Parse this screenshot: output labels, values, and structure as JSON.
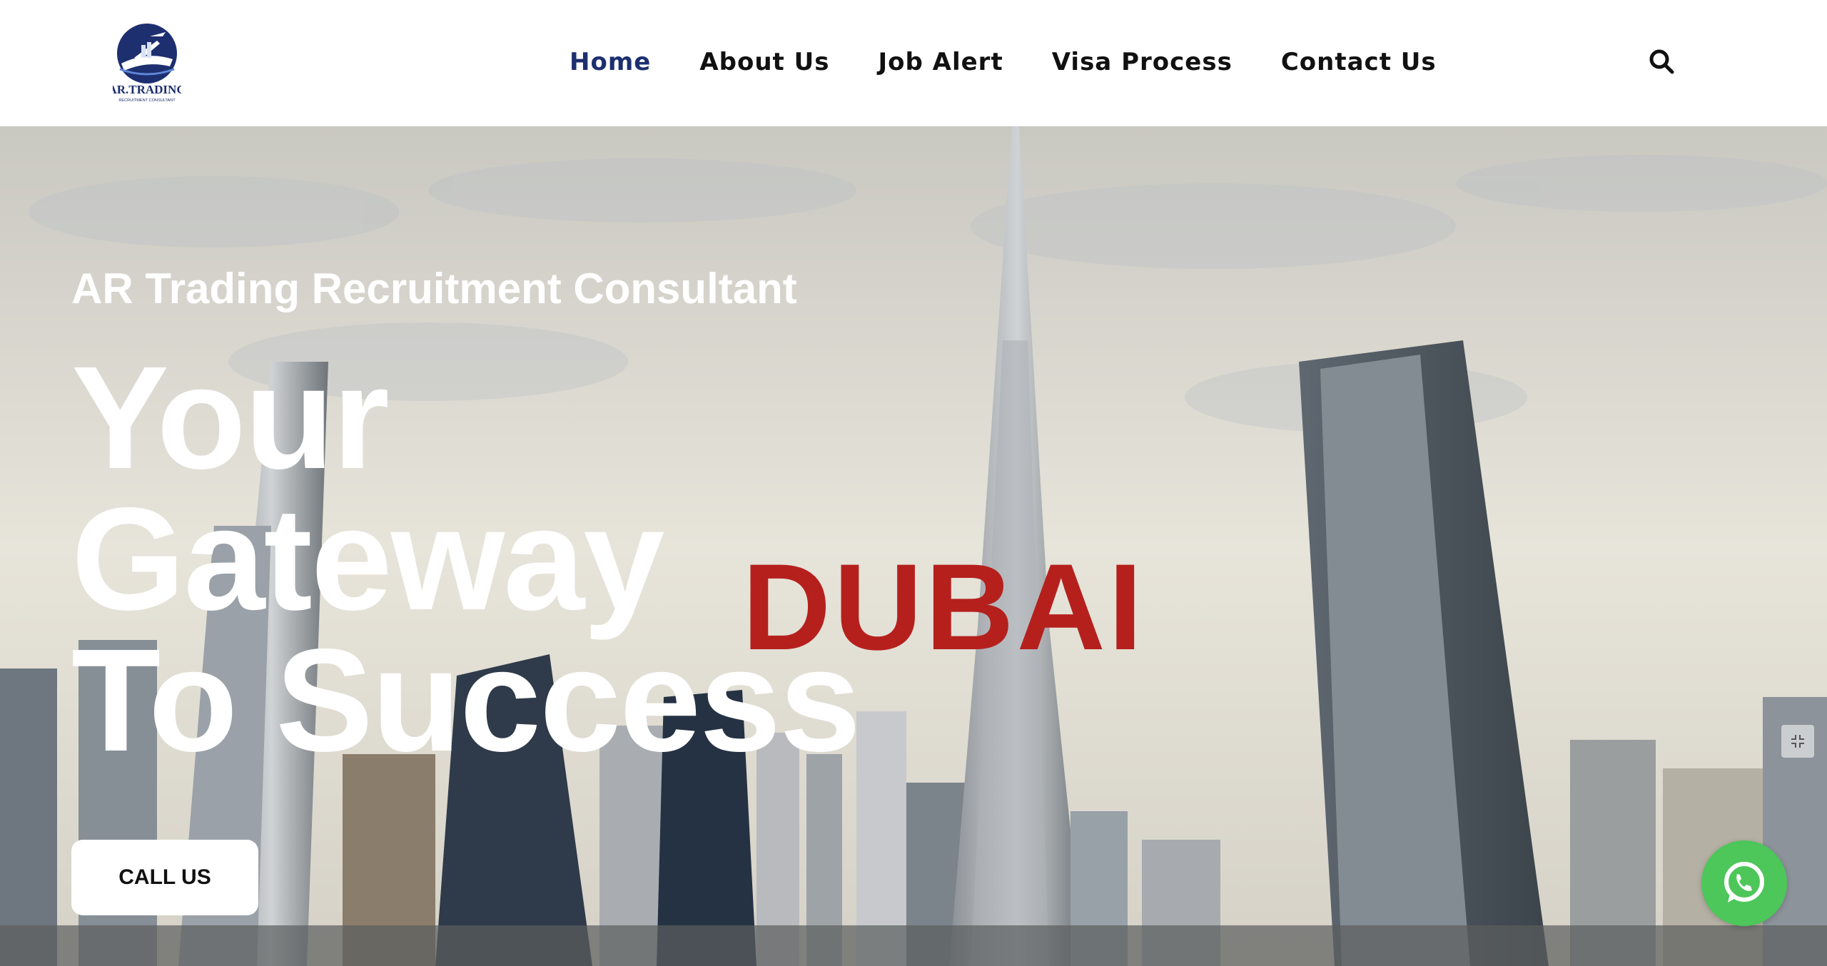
{
  "brand": {
    "logo_text": "AR.TRADING",
    "logo_tagline": "RECRUITMENT CONSULTANT",
    "colors": {
      "navy": "#1d2f6f",
      "whatsapp": "#4dc65a",
      "accent_red": "#b5201d"
    }
  },
  "nav": {
    "items": [
      {
        "label": "Home",
        "active": true
      },
      {
        "label": "About Us",
        "active": false
      },
      {
        "label": "Job Alert",
        "active": false
      },
      {
        "label": "Visa Process",
        "active": false
      },
      {
        "label": "Contact Us",
        "active": false
      }
    ],
    "search_icon": "search-icon"
  },
  "hero": {
    "eyebrow": "AR Trading Recruitment Consultant",
    "title_lines": [
      "Your",
      "Gateway",
      "To Success"
    ],
    "city_word": "DUBAI",
    "cta_label": "CALL US"
  },
  "floating": {
    "whatsapp_icon": "whatsapp-icon",
    "expand_icon": "expand-icon"
  }
}
